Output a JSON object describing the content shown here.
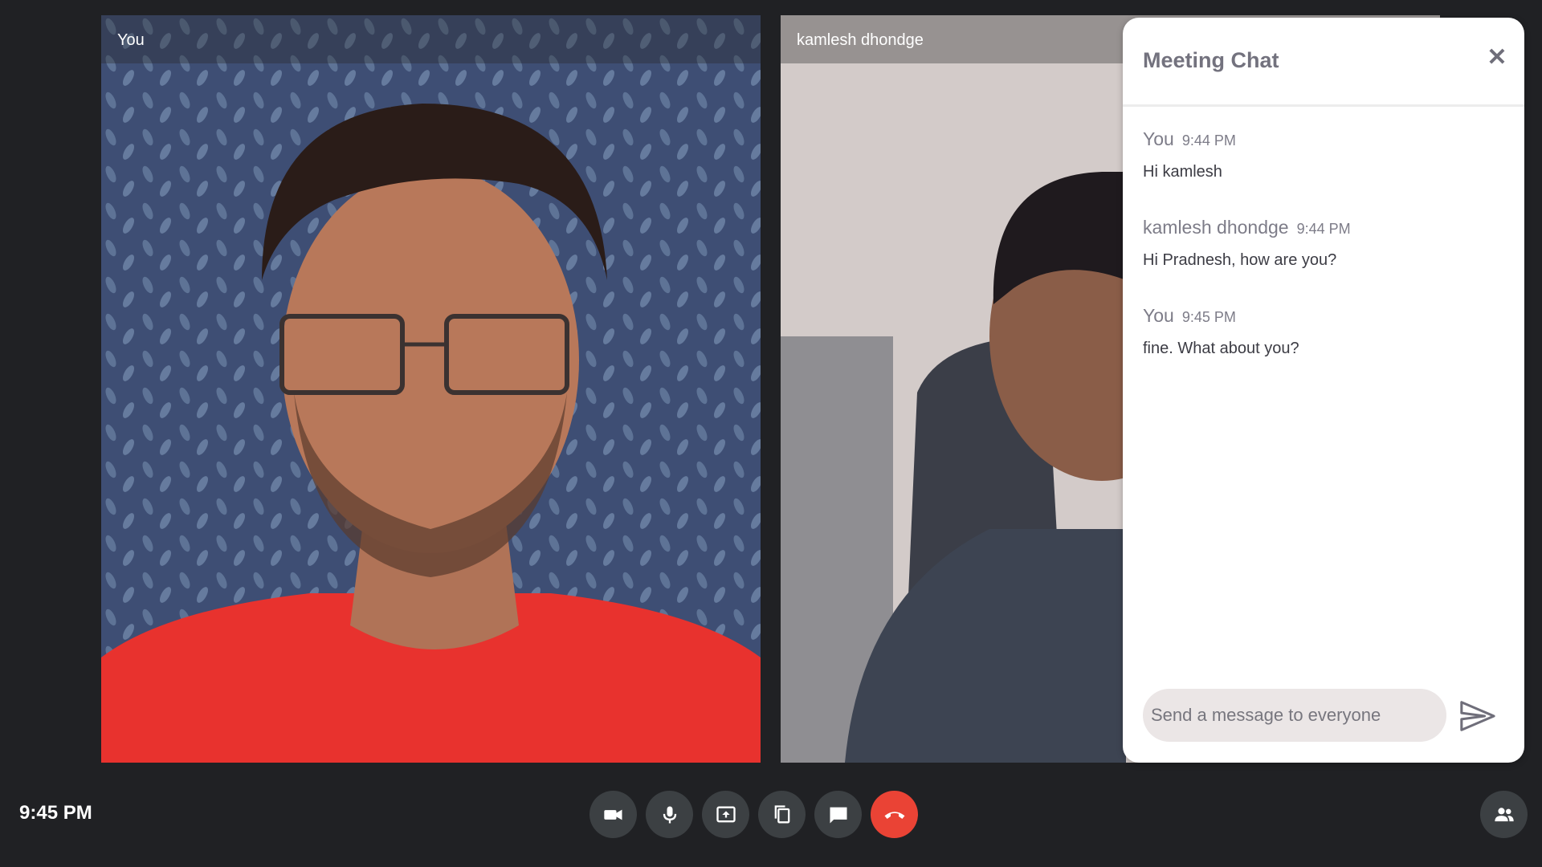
{
  "tiles": {
    "local": {
      "label": "You"
    },
    "remote": {
      "label": "kamlesh dhondge"
    }
  },
  "chat": {
    "title": "Meeting Chat",
    "close_icon": "close-icon",
    "messages": [
      {
        "sender": "You",
        "time": "9:44 PM",
        "text": "Hi kamlesh"
      },
      {
        "sender": "kamlesh dhondge",
        "time": "9:44 PM",
        "text": "Hi Pradnesh, how are you?"
      },
      {
        "sender": "You",
        "time": "9:45 PM",
        "text": "fine. What about you?"
      }
    ],
    "input_placeholder": "Send a message to everyone",
    "send_icon": "send-icon"
  },
  "footer": {
    "clock": "9:45 PM",
    "controls": [
      {
        "icon": "camera-icon"
      },
      {
        "icon": "microphone-icon"
      },
      {
        "icon": "present-screen-icon"
      },
      {
        "icon": "copy-link-icon"
      },
      {
        "icon": "chat-icon"
      },
      {
        "icon": "end-call-icon",
        "color": "#ea4335"
      }
    ],
    "people_icon": "people-icon"
  }
}
